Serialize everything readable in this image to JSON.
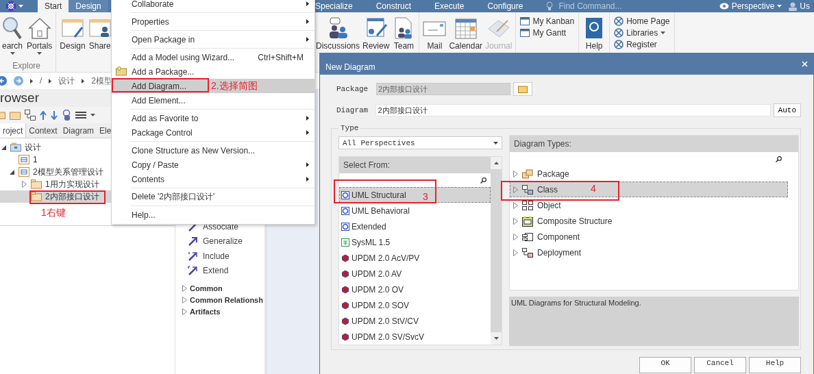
{
  "app_bar": {
    "tabs_left": [
      {
        "label": "Start",
        "selected": true
      },
      {
        "label": "Design",
        "selected": false
      }
    ],
    "tabs_right": [
      {
        "label": "Specialize",
        "selected": false
      },
      {
        "label": "Construct",
        "selected": false
      },
      {
        "label": "Execute",
        "selected": false
      },
      {
        "label": "Configure",
        "selected": false
      }
    ],
    "search": {
      "placeholder": "Find Command..."
    },
    "perspective": "Perspective",
    "user": "Us"
  },
  "ribbon": {
    "left_groups": [
      {
        "label": "Explore",
        "buttons": [
          {
            "label": "earch",
            "kind": "search",
            "dropdown": true
          },
          {
            "label": "Portals",
            "kind": "home",
            "dropdown": true
          }
        ]
      },
      {
        "buttons": [
          {
            "label": "Design",
            "kind": "design"
          },
          {
            "label": "Share",
            "kind": "share"
          }
        ]
      }
    ],
    "right_groups": [
      {
        "buttons": [
          {
            "label": "Discussions",
            "kind": "discussions",
            "disabled": false
          },
          {
            "label": "Review",
            "kind": "review",
            "disabled": false
          },
          {
            "label": "Team",
            "kind": "team",
            "disabled": false
          }
        ]
      },
      {
        "buttons": [
          {
            "label": "Mail",
            "kind": "mail",
            "disabled": false
          },
          {
            "label": "Calendar",
            "kind": "calendar",
            "disabled": false
          },
          {
            "label": "Journal",
            "kind": "journal",
            "disabled": true
          }
        ]
      },
      {
        "small": [
          {
            "label": "My Kanban",
            "kind": "window"
          },
          {
            "label": "My Gantt",
            "kind": "window"
          }
        ]
      },
      {
        "buttons": [
          {
            "label": "Help",
            "kind": "help",
            "disabled": false
          }
        ]
      },
      {
        "small": [
          {
            "label": "Home Page",
            "kind": "link"
          },
          {
            "label": "Libraries",
            "kind": "link",
            "dropdown": true
          },
          {
            "label": "Register",
            "kind": "link"
          }
        ]
      }
    ]
  },
  "breadcrumb": [
    "/",
    "设计",
    "2模型"
  ],
  "browser": {
    "title": "rowser",
    "tabs": [
      {
        "label": "roject",
        "selected": true
      },
      {
        "label": "Context",
        "selected": false
      },
      {
        "label": "Diagram",
        "selected": false
      },
      {
        "label": "Ele",
        "selected": false
      }
    ],
    "tree": [
      {
        "label": "设计",
        "kind": "model",
        "expanded": true,
        "selected": false,
        "children": [
          {
            "label": "1",
            "kind": "package",
            "selected": false
          },
          {
            "label": "2模型关系管理设计",
            "kind": "package",
            "expanded": true,
            "selected": false,
            "children": [
              {
                "label": "1用力实现设计",
                "kind": "folder",
                "expanded": false,
                "selected": false
              },
              {
                "label": "2内部接口设计",
                "kind": "folder",
                "selected": true
              }
            ]
          }
        ]
      }
    ]
  },
  "toolbox": {
    "items": [
      {
        "label": "Associate",
        "kind": "associate"
      },
      {
        "label": "Generalize",
        "kind": "generalize"
      },
      {
        "label": "Include",
        "kind": "include"
      },
      {
        "label": "Extend",
        "kind": "extend"
      }
    ],
    "groups": [
      {
        "label": "Common",
        "expanded": false
      },
      {
        "label": "Common Relationsh",
        "expanded": false
      },
      {
        "label": "Artifacts",
        "expanded": false
      }
    ]
  },
  "context_menu": {
    "items": [
      {
        "kind": "item",
        "label": "Collaborate",
        "submenu": true,
        "selected": false
      },
      {
        "kind": "separator"
      },
      {
        "kind": "item",
        "label": "Properties",
        "submenu": true,
        "selected": false
      },
      {
        "kind": "separator"
      },
      {
        "kind": "item",
        "label": "Open Package in",
        "submenu": true,
        "selected": false
      },
      {
        "kind": "separator"
      },
      {
        "kind": "item",
        "label": "Add a Model using Wizard...",
        "shortcut": "Ctrl+Shift+M",
        "selected": false
      },
      {
        "kind": "item",
        "label": "Add a Package...",
        "has_icon": true,
        "selected": false
      },
      {
        "kind": "item",
        "label": "Add Diagram...",
        "selected": true
      },
      {
        "kind": "item",
        "label": "Add Element...",
        "selected": false
      },
      {
        "kind": "separator"
      },
      {
        "kind": "item",
        "label": "Add as Favorite to",
        "submenu": true,
        "selected": false
      },
      {
        "kind": "item",
        "label": "Package Control",
        "submenu": true,
        "selected": false
      },
      {
        "kind": "separator"
      },
      {
        "kind": "item",
        "label": "Clone Structure as New Version...",
        "selected": false
      },
      {
        "kind": "item",
        "label": "Copy / Paste",
        "submenu": true,
        "selected": false
      },
      {
        "kind": "item",
        "label": "Contents",
        "submenu": true,
        "selected": false
      },
      {
        "kind": "separator"
      },
      {
        "kind": "item",
        "label": "Delete '2内部接口设计'",
        "selected": false
      },
      {
        "kind": "separator"
      },
      {
        "kind": "item",
        "label": "Help...",
        "selected": false
      }
    ]
  },
  "dialog": {
    "title": "New Diagram",
    "package": {
      "label": "Package",
      "value": "2内部接口设计",
      "disabled": true
    },
    "diagram": {
      "label": "Diagram",
      "value": "2内部接口设计"
    },
    "auto_button": "Auto",
    "type_group": {
      "label": "Type",
      "perspective": "All Perspectives",
      "select_from": {
        "header": "Select From:",
        "items": [
          {
            "label": "UML Structural",
            "kind": "uml",
            "selected": true
          },
          {
            "label": "UML Behavioral",
            "kind": "uml",
            "selected": false
          },
          {
            "label": "Extended",
            "kind": "uml",
            "selected": false
          },
          {
            "label": "SysML 1.5",
            "kind": "sysml",
            "selected": false
          },
          {
            "label": "UPDM 2.0 AcV/PV",
            "kind": "updm",
            "selected": false
          },
          {
            "label": "UPDM 2.0 AV",
            "kind": "updm",
            "selected": false
          },
          {
            "label": "UPDM 2.0 OV",
            "kind": "updm",
            "selected": false
          },
          {
            "label": "UPDM 2.0 SOV",
            "kind": "updm",
            "selected": false
          },
          {
            "label": "UPDM 2.0 StV/CV",
            "kind": "updm",
            "selected": false
          },
          {
            "label": "UPDM 2.0 SV/SvcV",
            "kind": "updm",
            "selected": false
          }
        ]
      },
      "diagram_types": {
        "header": "Diagram Types:",
        "items": [
          {
            "label": "Package",
            "kind": "package",
            "expanded": false,
            "selected": false
          },
          {
            "label": "Class",
            "kind": "class",
            "expanded": false,
            "selected": true
          },
          {
            "label": "Object",
            "kind": "object",
            "expanded": false,
            "selected": false
          },
          {
            "label": "Composite Structure",
            "kind": "composite",
            "expanded": false,
            "selected": false
          },
          {
            "label": "Component",
            "kind": "component",
            "expanded": false,
            "selected": false
          },
          {
            "label": "Deployment",
            "kind": "deployment",
            "expanded": false,
            "selected": false
          }
        ]
      },
      "description": "UML Diagrams for Structural Modeling."
    },
    "buttons": [
      "OK",
      "Cancel",
      "Help"
    ]
  },
  "annotations": [
    {
      "label": "2.选择简图"
    },
    {
      "label": "1右键"
    },
    {
      "label": "3"
    },
    {
      "label": "4"
    }
  ]
}
